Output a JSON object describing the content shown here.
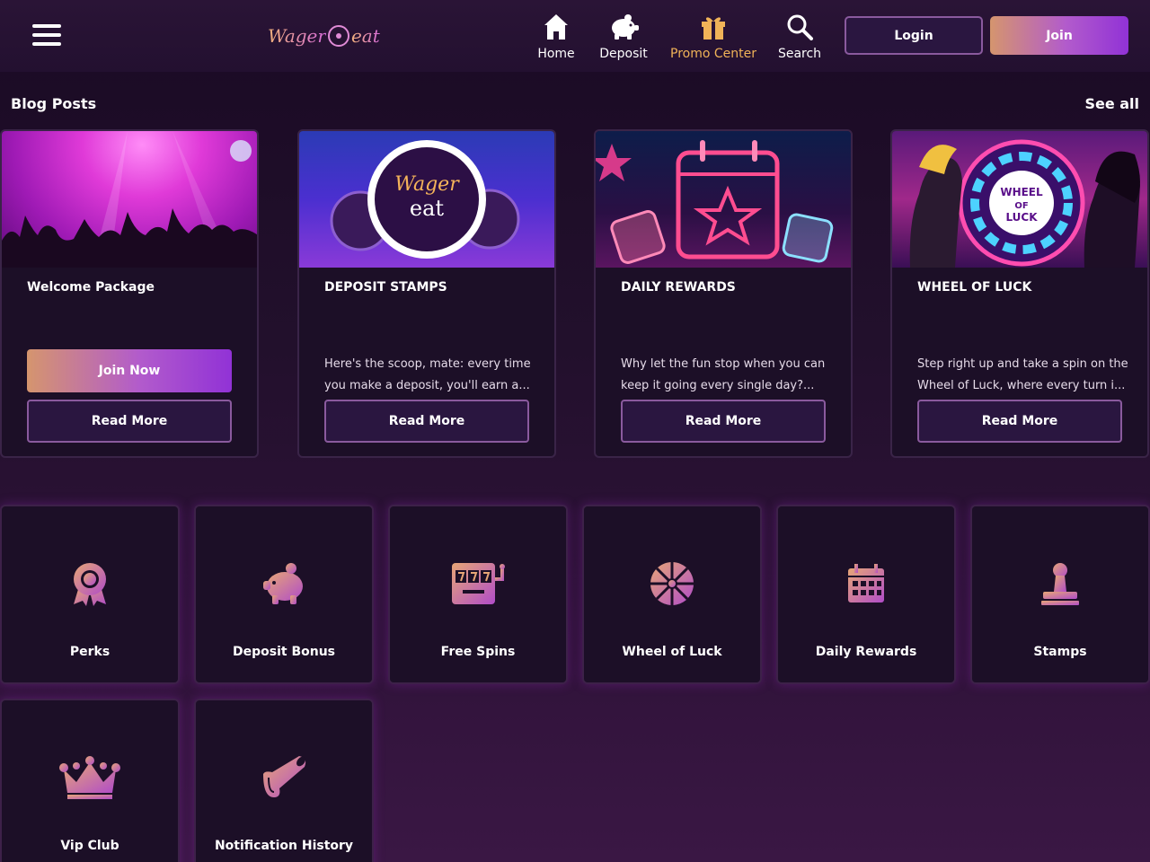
{
  "header": {
    "logo_text_left": "Wager",
    "logo_text_right": "eat",
    "nav": [
      {
        "label": "Home",
        "icon": "home-icon"
      },
      {
        "label": "Deposit",
        "icon": "piggy-bank-icon"
      },
      {
        "label": "Promo Center",
        "icon": "gift-icon",
        "active": true
      },
      {
        "label": "Search",
        "icon": "search-icon"
      }
    ],
    "login_label": "Login",
    "join_label": "Join"
  },
  "blog": {
    "title": "Blog Posts",
    "see_all_label": "See all",
    "cards": [
      {
        "title": "Welcome Package",
        "description": "",
        "join_label": "Join Now",
        "read_label": "Read More"
      },
      {
        "title": "DEPOSIT STAMPS",
        "description": "Here's the scoop, mate: every time you make a deposit, you'll earn a...",
        "read_label": "Read More"
      },
      {
        "title": "DAILY REWARDS",
        "description": "Why let the fun stop when you can keep it going every single day?...",
        "read_label": "Read More"
      },
      {
        "title": "WHEEL OF LUCK",
        "description": "Step right up and take a spin on the Wheel of Luck, where every turn i...",
        "read_label": "Read More"
      }
    ],
    "image_texts": {
      "stamp_word1": "Wager",
      "stamp_word2": "eat",
      "wheel_line1": "WHEEL",
      "wheel_line2": "OF",
      "wheel_line3": "LUCK"
    }
  },
  "tiles": [
    {
      "label": "Perks",
      "icon": "award-ribbon-icon"
    },
    {
      "label": "Deposit Bonus",
      "icon": "piggy-bank-icon"
    },
    {
      "label": "Free Spins",
      "icon": "slot-machine-icon"
    },
    {
      "label": "Wheel of Luck",
      "icon": "wheel-icon"
    },
    {
      "label": "Daily Rewards",
      "icon": "calendar-icon"
    },
    {
      "label": "Stamps",
      "icon": "stamp-icon"
    },
    {
      "label": "Vip Club",
      "icon": "crown-icon"
    },
    {
      "label": "Notification History",
      "icon": "megaphone-icon"
    }
  ],
  "colors": {
    "accent_gold": "#f0b358",
    "gradient_start": "#d5956e",
    "gradient_end": "#9132d6",
    "background": "#1a0a24"
  }
}
